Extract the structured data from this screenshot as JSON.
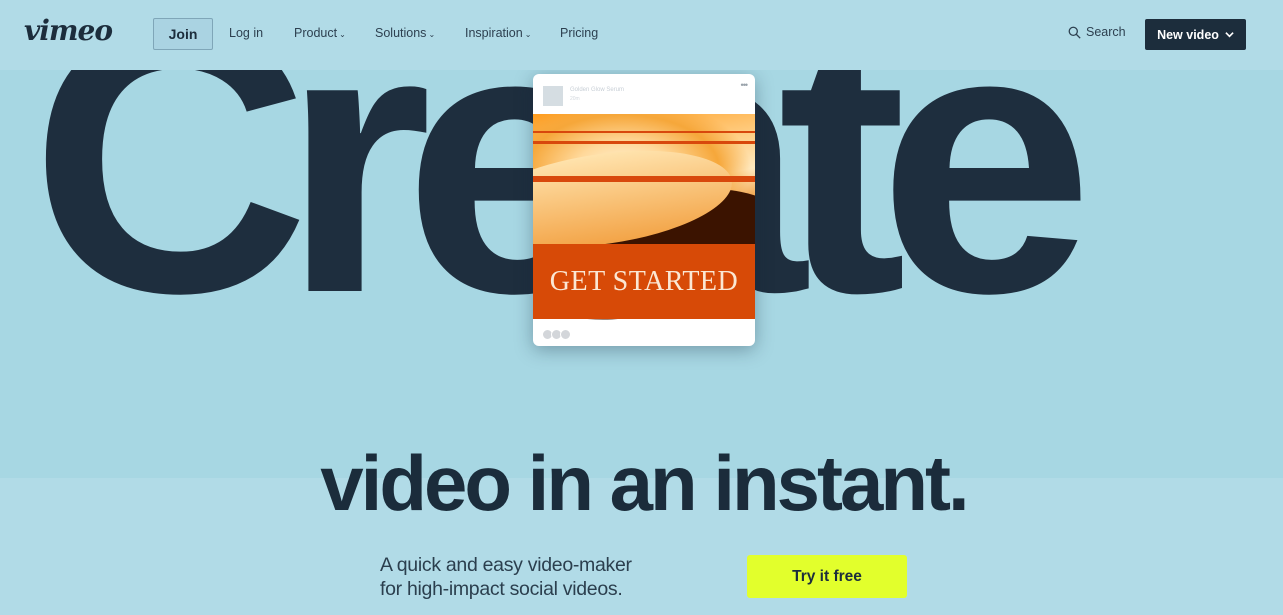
{
  "brand": {
    "logo_text": "vimeo"
  },
  "nav": {
    "join_label": "Join",
    "login_label": "Log in",
    "items": [
      {
        "label": "Product",
        "has_dropdown": true
      },
      {
        "label": "Solutions",
        "has_dropdown": true
      },
      {
        "label": "Inspiration",
        "has_dropdown": true
      },
      {
        "label": "Pricing",
        "has_dropdown": false
      }
    ],
    "search_label": "Search",
    "new_video_label": "New video"
  },
  "hero": {
    "headline_big": "Create",
    "headline_sub": "video in an instant.",
    "description_line1": "A quick and easy video-maker",
    "description_line2": "for high-impact social videos.",
    "cta_label": "Try it free"
  },
  "preview_card": {
    "account_name": "Golden Glow Serum",
    "post_time": "20m",
    "more_icon": "ellipsis-icon",
    "banner_text": "GET STARTED"
  },
  "colors": {
    "background": "#b1dbe7",
    "hero_band": "#a7d7e3",
    "ink": "#1c2d3c",
    "cta": "#e2ff2c",
    "card_banner": "#d74a07"
  }
}
